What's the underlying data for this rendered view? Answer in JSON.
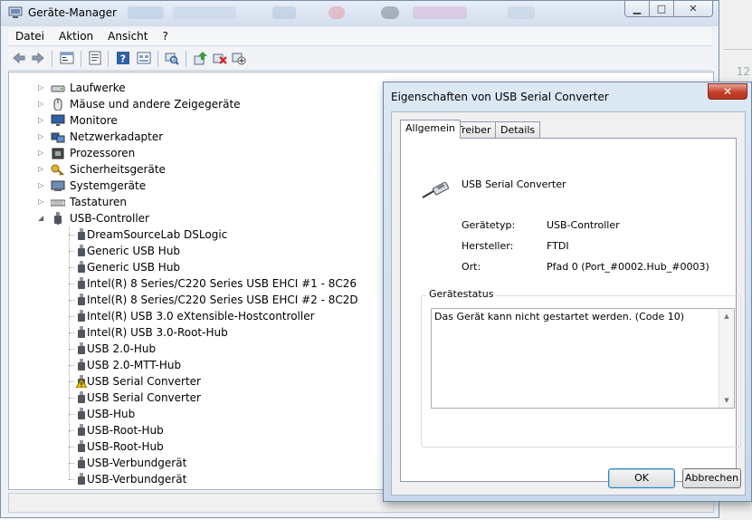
{
  "window": {
    "title": "Geräte-Manager",
    "buttons": {
      "minimize": "▁",
      "maximize": "□",
      "close": "✕"
    }
  },
  "menu": [
    "Datei",
    "Aktion",
    "Ansicht",
    "?"
  ],
  "toolbar_icons": [
    "back-icon",
    "forward-icon",
    "tree-view-icon",
    "properties-icon",
    "help-icon",
    "update-driver-icon",
    "scan-hardware-icon",
    "enable-device-icon",
    "uninstall-icon",
    "disable-device-icon"
  ],
  "tree": {
    "categories": [
      {
        "label": "Laufwerke",
        "expander": "▷",
        "icon": "drive-icon"
      },
      {
        "label": "Mäuse und andere Zeigegeräte",
        "expander": "▷",
        "icon": "mouse-icon"
      },
      {
        "label": "Monitore",
        "expander": "▷",
        "icon": "monitor-icon"
      },
      {
        "label": "Netzwerkadapter",
        "expander": "▷",
        "icon": "network-adapter-icon"
      },
      {
        "label": "Prozessoren",
        "expander": "▷",
        "icon": "processor-icon"
      },
      {
        "label": "Sicherheitsgeräte",
        "expander": "▷",
        "icon": "key-icon"
      },
      {
        "label": "Systemgeräte",
        "expander": "▷",
        "icon": "system-device-icon"
      },
      {
        "label": "Tastaturen",
        "expander": "▷",
        "icon": "keyboard-icon"
      },
      {
        "label": "USB-Controller",
        "expander": "◢",
        "icon": "usb-icon"
      }
    ],
    "usb_children": [
      {
        "label": "DreamSourceLab DSLogic",
        "warning": false
      },
      {
        "label": "Generic USB Hub",
        "warning": false
      },
      {
        "label": "Generic USB Hub",
        "warning": false
      },
      {
        "label": "Intel(R) 8 Series/C220 Series USB EHCI #1 - 8C26",
        "warning": false
      },
      {
        "label": "Intel(R) 8 Series/C220 Series USB EHCI #2 - 8C2D",
        "warning": false
      },
      {
        "label": "Intel(R) USB 3.0 eXtensible-Hostcontroller",
        "warning": false
      },
      {
        "label": "Intel(R) USB 3.0-Root-Hub",
        "warning": false
      },
      {
        "label": "USB 2.0-Hub",
        "warning": false
      },
      {
        "label": "USB 2.0-MTT-Hub",
        "warning": false
      },
      {
        "label": "USB Serial Converter",
        "warning": true
      },
      {
        "label": "USB Serial Converter",
        "warning": false
      },
      {
        "label": "USB-Hub",
        "warning": false
      },
      {
        "label": "USB-Root-Hub",
        "warning": false
      },
      {
        "label": "USB-Root-Hub",
        "warning": false
      },
      {
        "label": "USB-Verbundgerät",
        "warning": false
      },
      {
        "label": "USB-Verbundgerät",
        "warning": false
      }
    ]
  },
  "dialog": {
    "title": "Eigenschaften von USB Serial Converter",
    "close": "✕",
    "tabs": [
      "Allgemein",
      "Treiber",
      "Details"
    ],
    "active_tab": "Allgemein",
    "device_name": "USB Serial Converter",
    "properties": [
      {
        "key": "Gerätetyp:",
        "value": "USB-Controller"
      },
      {
        "key": "Hersteller:",
        "value": "FTDI"
      },
      {
        "key": "Ort:",
        "value": "Pfad 0 (Port_#0002.Hub_#0003)"
      }
    ],
    "status_group_label": "Gerätestatus",
    "status_text": "Das Gerät kann nicht gestartet werden. (Code 10)",
    "ok_label": "OK",
    "cancel_label": "Abbrechen"
  },
  "background": {
    "number": "12"
  },
  "colors": {
    "accent": "#3c7fb1",
    "close_red": "#c4402a",
    "warning": "#f2c200"
  }
}
